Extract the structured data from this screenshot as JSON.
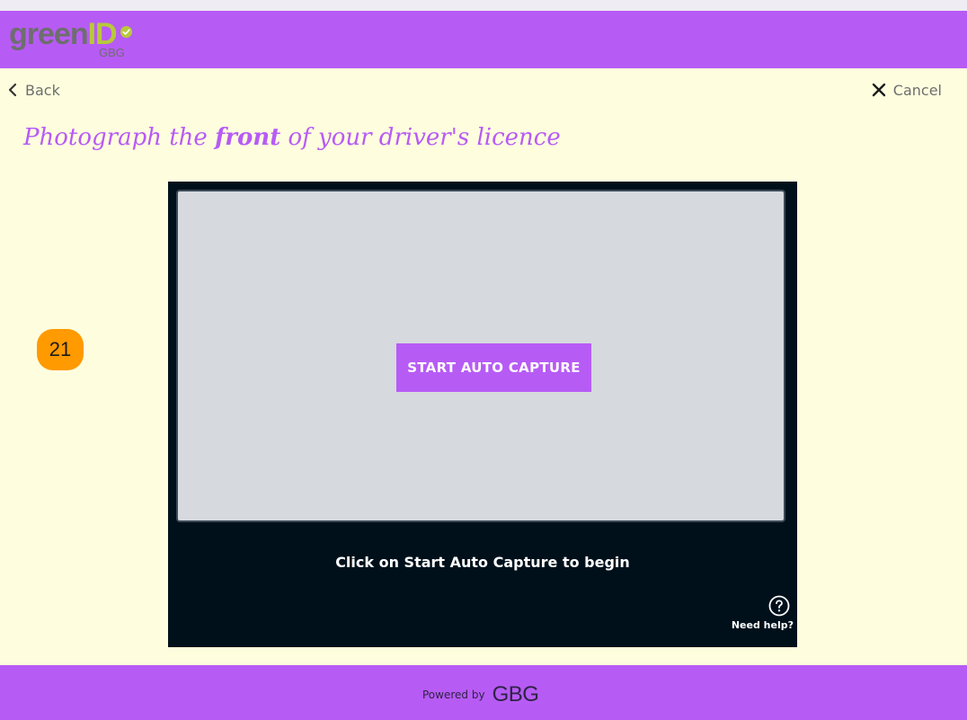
{
  "header": {
    "logo_text_main": "green",
    "logo_text_id": "ID",
    "logo_sub": "GBG",
    "icon": "checkmark-circle-icon"
  },
  "nav": {
    "back_label": "Back",
    "back_icon": "chevron-left-icon",
    "cancel_label": "Cancel",
    "cancel_icon": "close-icon"
  },
  "title": {
    "before": "Photograph the ",
    "emphasis": "front",
    "after": " of your driver's licence"
  },
  "badge": {
    "number": "21"
  },
  "capture": {
    "button_label": "START AUTO CAPTURE",
    "instruction": "Click on Start Auto Capture to begin",
    "help_label": "Need help?",
    "help_icon": "question-circle-icon"
  },
  "footer": {
    "powered_by": "Powered by",
    "brand": "GBG"
  },
  "colors": {
    "brand_purple": "#b75bf5",
    "background": "#fefedf",
    "capture_bg": "#00101b",
    "badge_orange": "#ff9a00",
    "logo_green": "#b8c93a"
  }
}
